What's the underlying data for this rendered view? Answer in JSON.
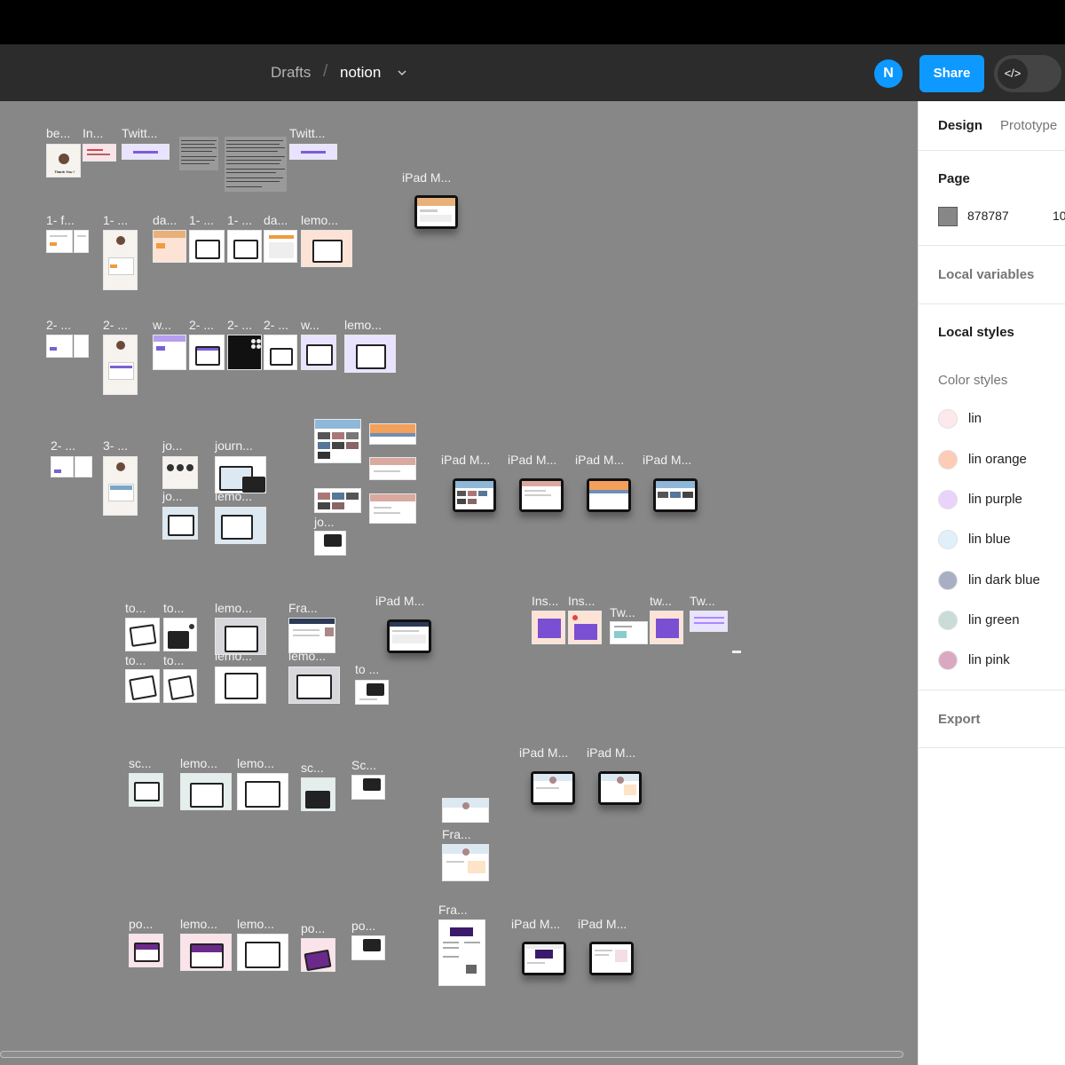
{
  "toolbar": {
    "breadcrumb_root": "Drafts",
    "breadcrumb_sep": "/",
    "file_name": "notion",
    "avatar_initial": "N",
    "share_label": "Share",
    "dev_mode_icon": "</>"
  },
  "canvas": {
    "background": "#878787",
    "labels": {
      "r1": [
        "be...",
        "In...",
        "Twitt...",
        "Twitt...",
        "iPad M..."
      ],
      "r2": [
        "1- f...",
        "1- ...",
        "da...",
        "1- ...",
        "1- ...",
        "da...",
        "lemo..."
      ],
      "r3": [
        "2- ...",
        "2- ...",
        "w...",
        "2- ...",
        "2- ...",
        "2- ...",
        "w...",
        "lemo..."
      ],
      "r4": [
        "2- ...",
        "3- ...",
        "jo...",
        "journ...",
        "jo...",
        "lemo...",
        "jo...",
        "iPad M...",
        "iPad M...",
        "iPad M...",
        "iPad M..."
      ],
      "r5": [
        "to...",
        "to...",
        "lemo...",
        "Fra...",
        "iPad M...",
        "to...",
        "to...",
        "lemo...",
        "lemo...",
        "to ...",
        "Ins...",
        "Ins...",
        "Tw...",
        "tw...",
        "Tw..."
      ],
      "r6": [
        "sc...",
        "lemo...",
        "lemo...",
        "sc...",
        "Sc...",
        "iPad M...",
        "iPad M...",
        "Fra..."
      ],
      "r7": [
        "Fra...",
        "po...",
        "lemo...",
        "lemo...",
        "po...",
        "po...",
        "iPad M...",
        "iPad M..."
      ]
    },
    "thumb_texts": {
      "thank_you": "Thank You !"
    }
  },
  "panel": {
    "tabs": [
      "Design",
      "Prototype"
    ],
    "page_section": "Page",
    "page_color_hex": "878787",
    "page_opacity": "10",
    "local_variables": "Local variables",
    "local_styles": "Local styles",
    "color_styles_heading": "Color styles",
    "color_styles": [
      {
        "name": "lin",
        "color": "#fde8ec"
      },
      {
        "name": "lin orange",
        "color": "#fdcbb6"
      },
      {
        "name": "lin purple",
        "color": "#e9d3fb"
      },
      {
        "name": "lin blue",
        "color": "#dff0fb"
      },
      {
        "name": "lin dark blue",
        "color": "#a8aec4"
      },
      {
        "name": "lin green",
        "color": "#c9dcd8"
      },
      {
        "name": "lin pink",
        "color": "#dba8c2"
      }
    ],
    "export": "Export"
  }
}
